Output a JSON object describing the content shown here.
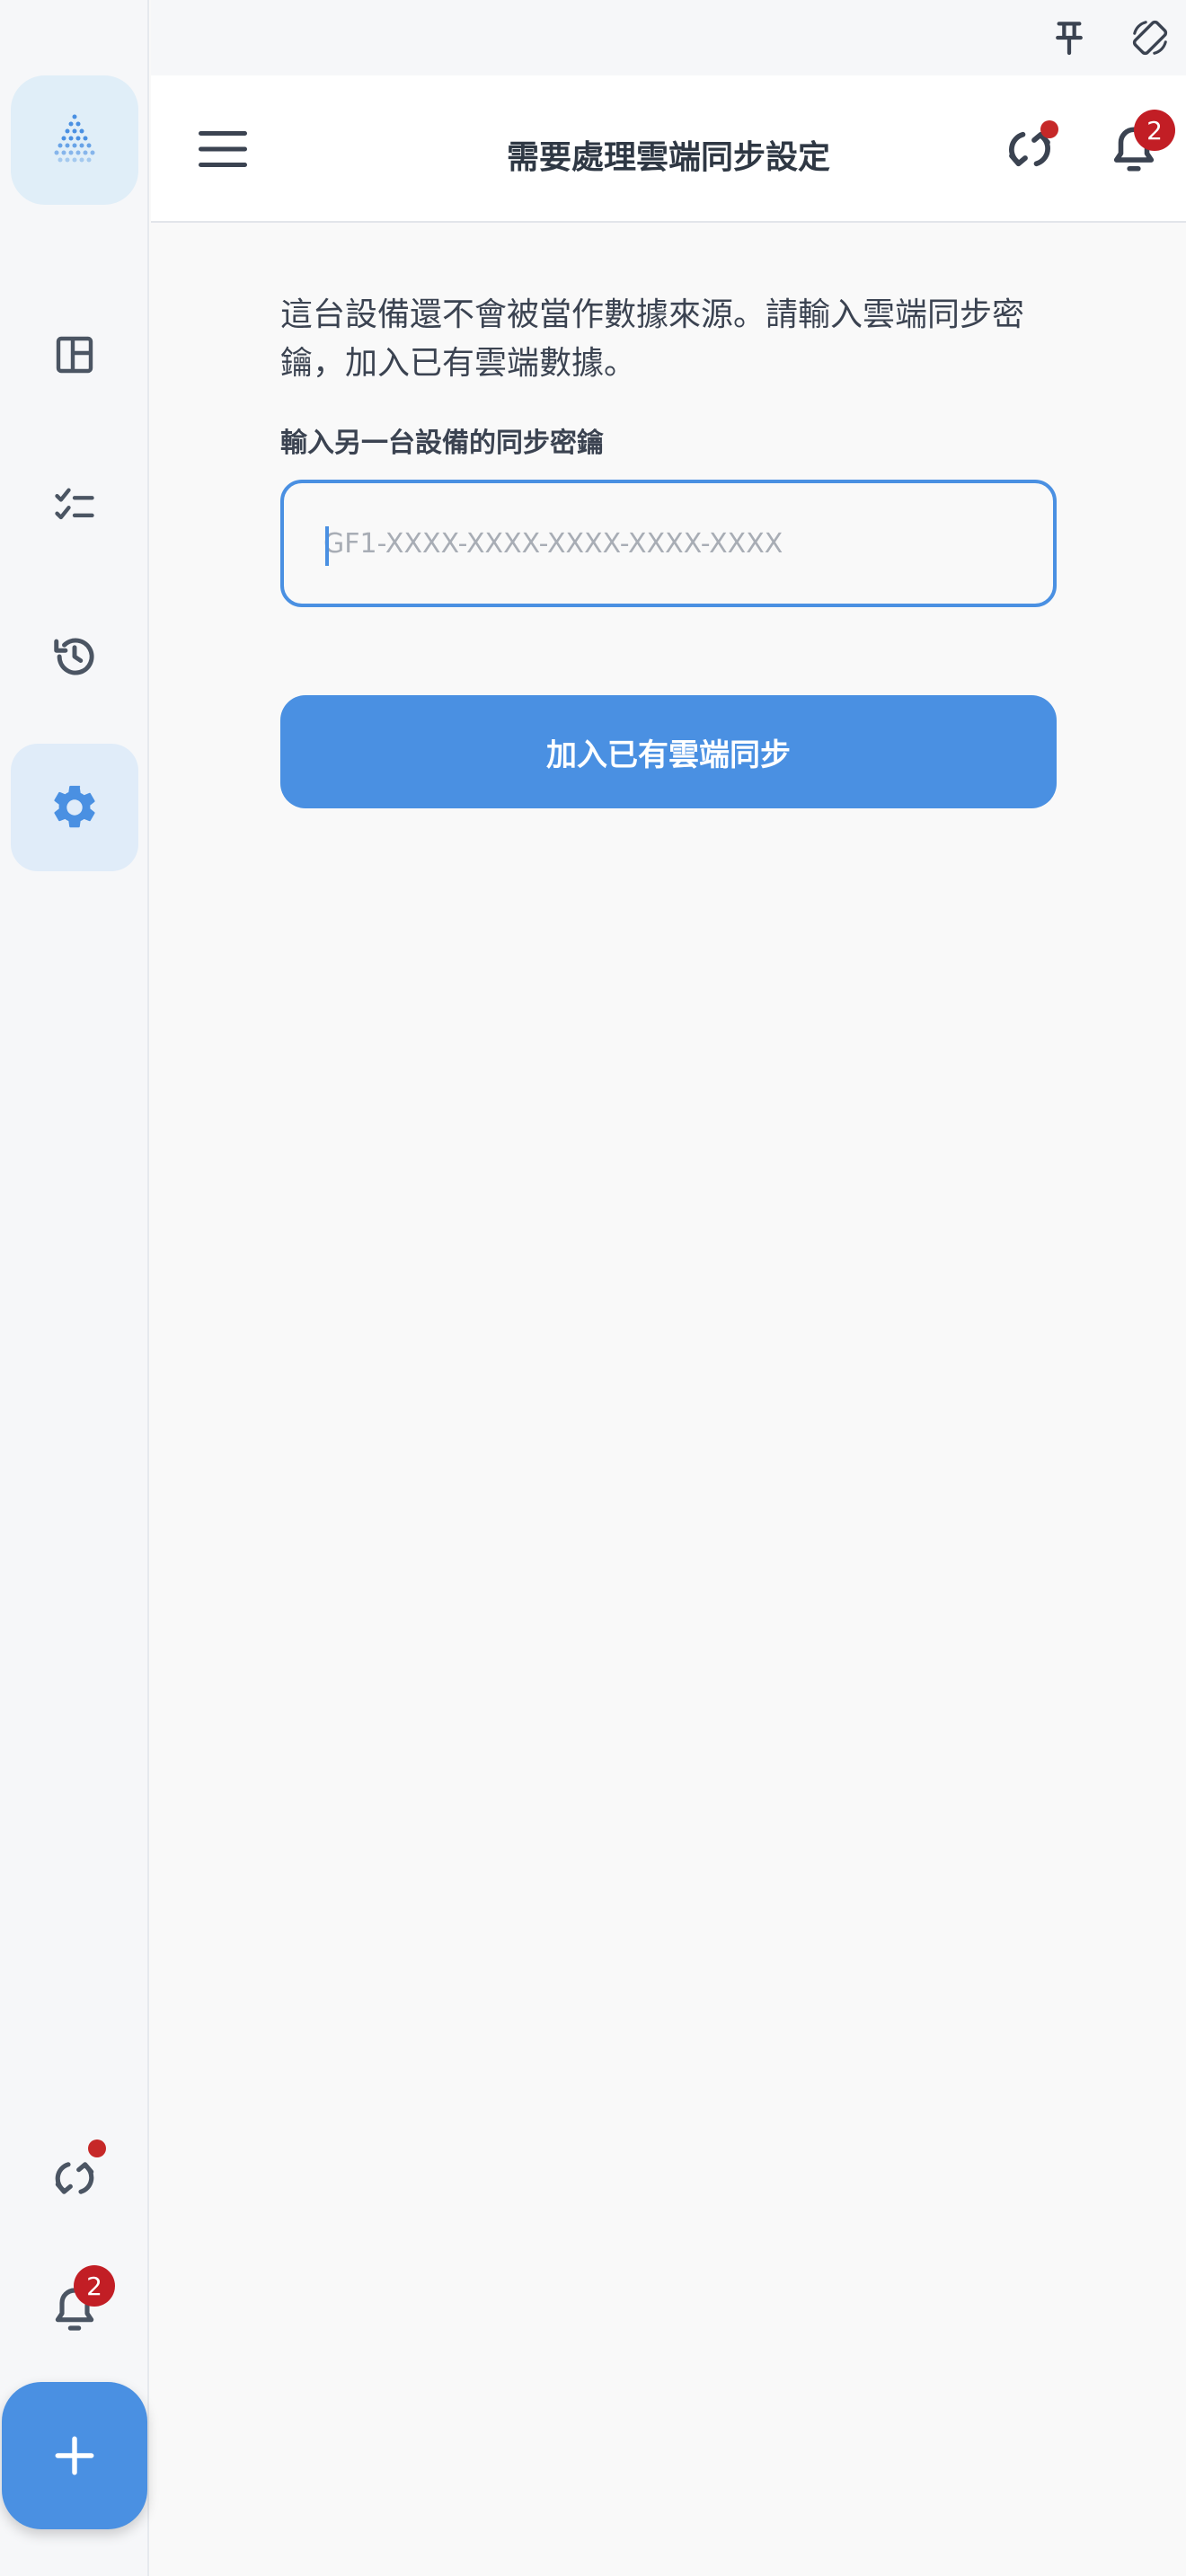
{
  "header": {
    "title": "需要處理雲端同步設定",
    "notification_count": "2"
  },
  "sidebar": {
    "notification_count": "2",
    "items": [
      "dashboard",
      "tasks",
      "history",
      "settings"
    ],
    "active": "settings"
  },
  "main": {
    "description": "這台設備還不會被當作數據來源。請輸入雲端同步密鑰，加入已有雲端數據。",
    "field_label": "輸入另一台設備的同步密鑰",
    "key_placeholder": "GF1-XXXX-XXXX-XXXX-XXXX-XXXX",
    "join_button_label": "加入已有雲端同步"
  },
  "colors": {
    "accent": "#4a90e2",
    "badge": "#c21e25",
    "active_nav_bg": "#e0ecf9"
  }
}
